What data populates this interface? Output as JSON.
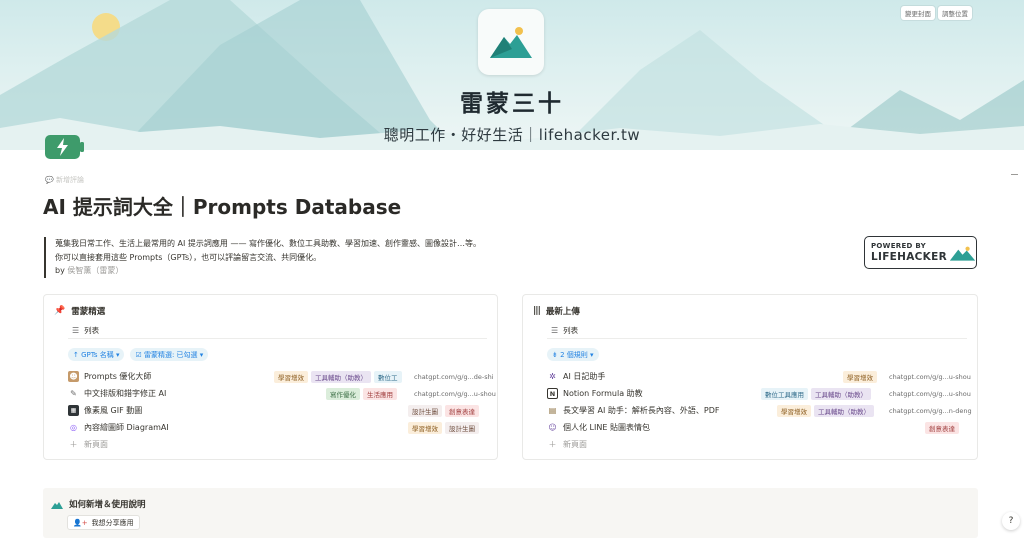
{
  "cover": {
    "change_cover": "變更封面",
    "reposition": "調整位置",
    "title": "雷蒙三十",
    "subtitle": "聰明工作・好好生活｜lifehacker.tw"
  },
  "page": {
    "icon": "battery-charging-icon",
    "comment_hint": "新增評論",
    "title": "AI 提示詞大全｜Prompts Database",
    "desc_line1": "蒐集我日常工作、生活上最常用的 AI 提示詞應用 —— 寫作優化、數位工具助教、學習加速、創作靈感、圖像設計…等。",
    "desc_line2": "你可以直接套用這些 Prompts（GPTs），也可以評論留言交流、共同優化。",
    "by_prefix": "by ",
    "by_name": "侯智薰（雷蒙）"
  },
  "badge": {
    "line1": "POWERED BY",
    "line2": "LIFEHACKER"
  },
  "left_db": {
    "title": "雷蒙精選",
    "view": "列表",
    "filters": [
      "↑ GPTs 名稱 ▾",
      "☑ 雷蒙精選: 已勾選 ▾"
    ],
    "rows": [
      {
        "name": "Prompts 優化大師",
        "tags": [
          "學習增效",
          "工具輔助（助教）",
          "數位工"
        ],
        "url": "chatgpt.com/g/g...de-shi"
      },
      {
        "name": "中文排版和錯字修正 AI",
        "tags": [
          "寫作優化",
          "生活應用"
        ],
        "url": "chatgpt.com/g/g...u-shou"
      },
      {
        "name": "像素風 GIF 動圖",
        "tags": [
          "設計生圖",
          "創意表達"
        ],
        "url": ""
      },
      {
        "name": "內容繪圖師 DiagramAI",
        "tags": [
          "學習增效",
          "設計生圖"
        ],
        "url": ""
      }
    ],
    "new_page": "新頁面"
  },
  "right_db": {
    "title": "最新上傳",
    "view": "列表",
    "filters": [
      "⇟ 2 個規則 ▾"
    ],
    "rows": [
      {
        "name": "AI 日記助手",
        "tags": [
          "學習增效"
        ],
        "url": "chatgpt.com/g/g...u-shou"
      },
      {
        "name": "Notion Formula 助教",
        "tags": [
          "數位工具應用",
          "工具輔助（助教）"
        ],
        "url": "chatgpt.com/g/g...u-shou"
      },
      {
        "name": "長文學習 AI 助手：解析長內容、外語、PDF",
        "tags": [
          "學習增效",
          "工具輔助（助教）"
        ],
        "url": "chatgpt.com/g/g...n-deng"
      },
      {
        "name": "個人化 LINE 貼圖表情包",
        "tags": [
          "創意表達"
        ],
        "url": ""
      }
    ],
    "new_page": "新頁面"
  },
  "callout": {
    "title": "如何新增＆使用說明",
    "button": "我想分享應用"
  },
  "help": "?",
  "colors": {
    "tag_yellow": "#fbeedb",
    "tag_purple": "#eae4f2",
    "tag_blue": "#e7f3f8",
    "tag_green": "#dbeddb",
    "tag_red": "#fbe4e4",
    "tag_brown": "#f4eeee",
    "link_blue": "#2383e2"
  }
}
